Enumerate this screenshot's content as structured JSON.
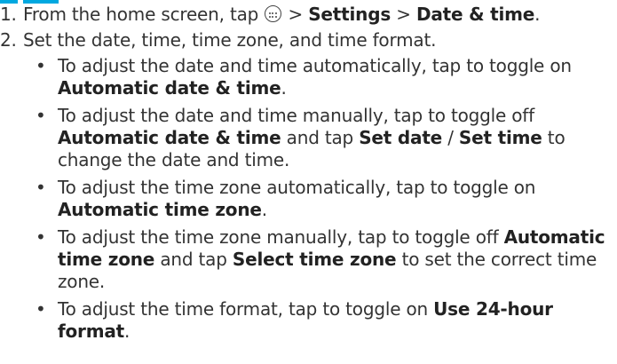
{
  "instructions": {
    "step1": {
      "number": "1.",
      "before_icon": "From the home screen, tap",
      "icon": "apps-grid-icon",
      "sep1": ">",
      "settings": "Settings",
      "sep2": ">",
      "date_time": "Date & time",
      "end": "."
    },
    "step2": {
      "number": "2.",
      "text": "Set the date, time, time zone, and time format."
    },
    "bullets": [
      {
        "dot": "•",
        "parts": [
          {
            "t": "To adjust the date and time automatically, tap to toggle on ",
            "b": false
          },
          {
            "t": "Automatic date & time",
            "b": true
          },
          {
            "t": ".",
            "b": false
          }
        ]
      },
      {
        "dot": "•",
        "parts": [
          {
            "t": "To adjust the date and time manually, tap to toggle off ",
            "b": false
          },
          {
            "t": "Automatic date & time",
            "b": true
          },
          {
            "t": " and tap ",
            "b": false
          },
          {
            "t": "Set date",
            "b": true
          },
          {
            "t": " / ",
            "b": false
          },
          {
            "t": "Set time",
            "b": true
          },
          {
            "t": " to change the date and time.",
            "b": false
          }
        ]
      },
      {
        "dot": "•",
        "parts": [
          {
            "t": "To adjust the time zone automatically, tap to toggle on ",
            "b": false
          },
          {
            "t": "Automatic time zone",
            "b": true
          },
          {
            "t": ".",
            "b": false
          }
        ]
      },
      {
        "dot": "•",
        "parts": [
          {
            "t": "To adjust the time zone manually, tap to toggle off ",
            "b": false
          },
          {
            "t": "Automatic time zone",
            "b": true
          },
          {
            "t": " and tap ",
            "b": false
          },
          {
            "t": "Select time zone",
            "b": true
          },
          {
            "t": " to set the correct time zone.",
            "b": false
          }
        ]
      },
      {
        "dot": "•",
        "parts": [
          {
            "t": "To adjust the time format, tap to toggle on ",
            "b": false
          },
          {
            "t": "Use 24-hour format",
            "b": true
          },
          {
            "t": ".",
            "b": false
          }
        ]
      }
    ]
  },
  "colors": {
    "accent": "#00a8e0",
    "text": "#333333"
  }
}
